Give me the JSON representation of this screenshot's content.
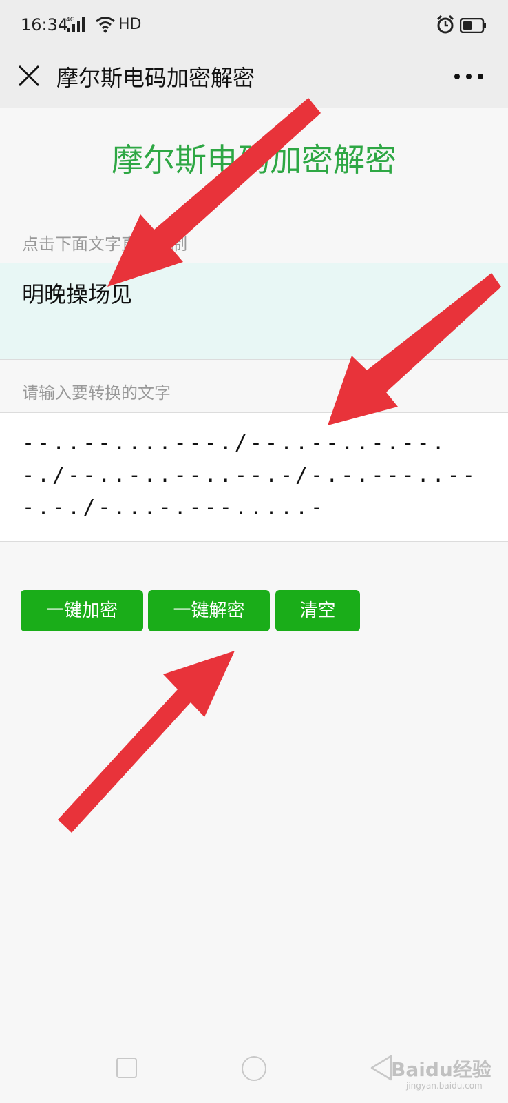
{
  "status_bar": {
    "time": "16:34",
    "network": "4G",
    "hd": "HD",
    "icons": [
      "signal-icon",
      "wifi-icon",
      "alarm-icon",
      "battery-icon"
    ]
  },
  "title_bar": {
    "title": "摩尔斯电码加密解密",
    "close_icon": "close-icon",
    "more_icon": "more-icon"
  },
  "main": {
    "heading": "摩尔斯电码加密解密",
    "copy_hint": "点击下面文字直接复制",
    "result_text": "明晚操场见",
    "input_hint": "请输入要转换的文字",
    "input_value": "--..--....---./--..--..-.--.-./--..-..--..--.-/-.-.---..---.-./-...-.---.....-"
  },
  "buttons": {
    "encrypt": "一键加密",
    "decrypt": "一键解密",
    "clear": "清空"
  },
  "nav_bar": {
    "icons": [
      "recent-apps-icon",
      "home-icon",
      "back-icon"
    ]
  },
  "watermark": {
    "text": "Baidu经验",
    "sub": "jingyan.baidu.com"
  },
  "colors": {
    "accent_green": "#1aad19",
    "heading_green": "#2ea744",
    "annotation_red": "#e8333a"
  }
}
